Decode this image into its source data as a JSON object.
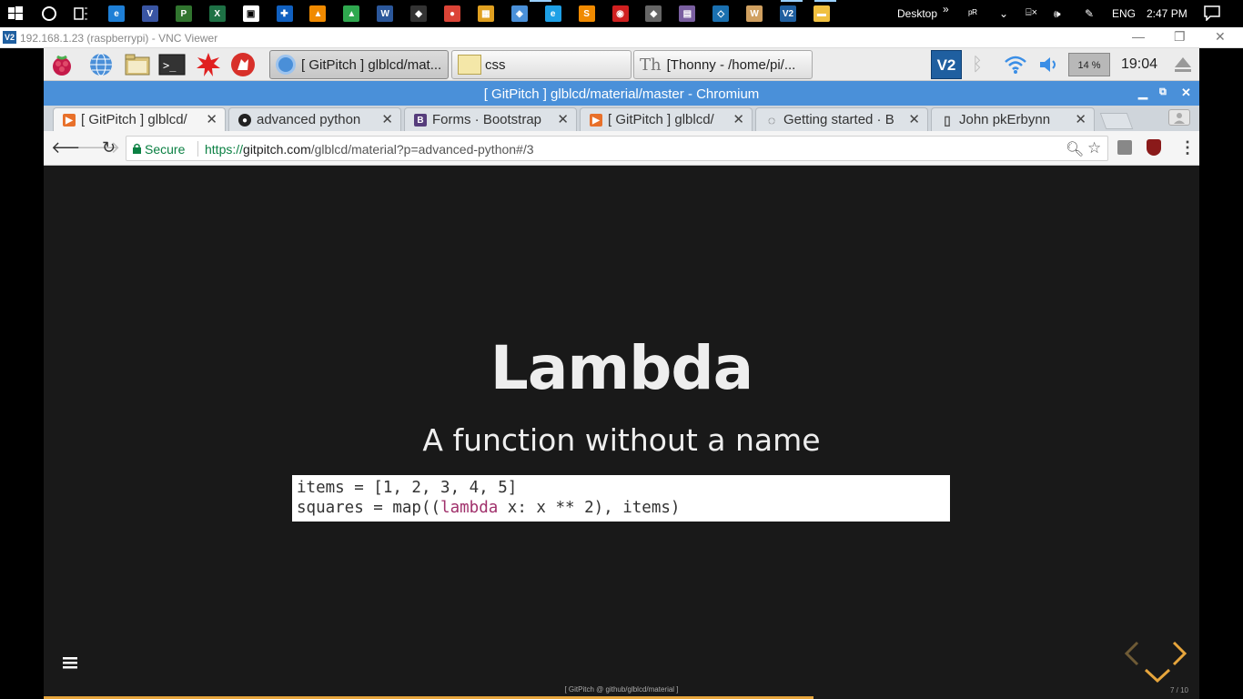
{
  "taskbar": {
    "icons": [
      {
        "name": "start-icon"
      },
      {
        "name": "cortana-icon"
      },
      {
        "name": "task-view-icon"
      },
      {
        "name": "edge-icon",
        "color": "#1e7fd6",
        "glyph": "e"
      },
      {
        "name": "visio-icon",
        "color": "#3955a3",
        "glyph": "V"
      },
      {
        "name": "project-icon",
        "color": "#31752f",
        "glyph": "P"
      },
      {
        "name": "excel-icon",
        "color": "#1e7145",
        "glyph": "X"
      },
      {
        "name": "store-icon",
        "color": "#ffffff",
        "glyph": "▣"
      },
      {
        "name": "defender-icon",
        "color": "#1060c0",
        "glyph": "✚"
      },
      {
        "name": "vlc-icon",
        "color": "#f08a00",
        "glyph": "▲"
      },
      {
        "name": "app-green-icon",
        "color": "#2fa84f",
        "glyph": "▲"
      },
      {
        "name": "word-icon",
        "color": "#2b579a",
        "glyph": "W"
      },
      {
        "name": "notes-icon",
        "color": "#333333",
        "glyph": "◆"
      },
      {
        "name": "chrome-icon",
        "color": "#db4437",
        "glyph": "●"
      },
      {
        "name": "tiles-icon",
        "color": "#e0a020",
        "glyph": "▦"
      },
      {
        "name": "box-icon",
        "color": "#4a90d9",
        "glyph": "◈"
      },
      {
        "name": "ie-icon",
        "color": "#1ea0e6",
        "glyph": "e"
      },
      {
        "name": "sublime-icon",
        "color": "#f08a00",
        "glyph": "S"
      },
      {
        "name": "record-icon",
        "color": "#d02020",
        "glyph": "◉"
      },
      {
        "name": "git-icon",
        "color": "#666666",
        "glyph": "◆"
      },
      {
        "name": "image-icon",
        "color": "#7a5fa0",
        "glyph": "▤"
      },
      {
        "name": "shield-app-icon",
        "color": "#1a70b0",
        "glyph": "◇"
      },
      {
        "name": "wordpad-icon",
        "color": "#d0a060",
        "glyph": "W"
      },
      {
        "name": "vnc-icon",
        "color": "#1f5fa0",
        "glyph": "V2"
      },
      {
        "name": "explorer-icon",
        "color": "#f0c040",
        "glyph": "▬"
      }
    ],
    "desktop_label": "Desktop",
    "language": "ENG",
    "clock": "2:47 PM"
  },
  "vnc": {
    "title": "192.168.1.23 (raspberrypi) - VNC Viewer"
  },
  "lxpanel": {
    "tasks": [
      {
        "label": "[ GitPitch ] glblcd/mat..."
      },
      {
        "label": "css"
      },
      {
        "label": "[Thonny  -  /home/pi/..."
      }
    ],
    "cpu_label": "14 %",
    "clock": "19:04"
  },
  "chromium": {
    "window_title": "[ GitPitch ] glblcd/material/master - Chromium",
    "tabs": [
      {
        "label": "[ GitPitch ] glblcd/",
        "fav": "▶",
        "fav_color": "#e8702a"
      },
      {
        "label": "advanced python",
        "fav": "●",
        "fav_color": "#222222"
      },
      {
        "label": "Forms · Bootstrap",
        "fav": "B",
        "fav_color": "#563d7c"
      },
      {
        "label": "[ GitPitch ] glblcd/",
        "fav": "▶",
        "fav_color": "#e8702a"
      },
      {
        "label": "Getting started · B",
        "fav": "◌",
        "fav_color": "#dde2e7"
      },
      {
        "label": "John pkErbynn",
        "fav": "▯",
        "fav_color": "#dde2e7"
      }
    ],
    "secure_label": "Secure",
    "url_proto": "https://",
    "url_host": "gitpitch.com",
    "url_path": "/glblcd/material?p=advanced-python#/3"
  },
  "slide": {
    "title": "Lambda",
    "subtitle": "A function without a name",
    "code_line1": "items = [1, 2, 3, 4, 5]",
    "code_line2_pre": "squares = map((",
    "code_keyword": "lambda",
    "code_line2_post": " x: x ** 2), items)",
    "footer": "[ GitPitch @ github/glblcd/material ]",
    "slide_number": "7 / 10",
    "progress_fraction": 0.666,
    "accent_color": "#e6a53c"
  }
}
